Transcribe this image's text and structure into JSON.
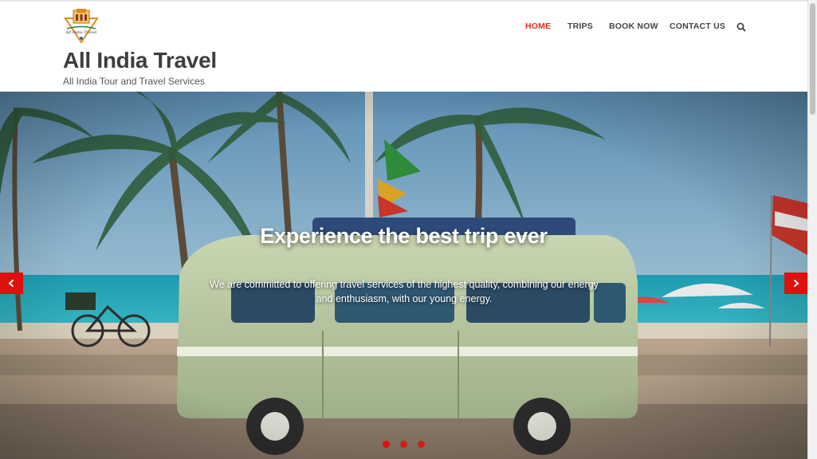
{
  "site": {
    "title": "All India Travel",
    "tagline": "All India Tour and Travel Services",
    "logo_text": "All India Travel"
  },
  "nav": {
    "items": [
      {
        "label": "HOME",
        "active": true
      },
      {
        "label": "TRIPS",
        "active": false
      },
      {
        "label": "BOOK NOW",
        "active": false
      },
      {
        "label": "CONTACT US",
        "active": false
      }
    ],
    "search_icon": "search-icon"
  },
  "hero": {
    "title": "Experience the best trip ever",
    "text": "We are committed to offering travel services of the highest quality, combining our energy and enthusiasm, with our young energy.",
    "prev_icon": "chevron-left-icon",
    "next_icon": "chevron-right-icon",
    "slide_count": 3,
    "active_slide": 1
  },
  "colors": {
    "accent": "#e02b20",
    "title": "#3d3d3d",
    "slider_control": "#e0100c"
  }
}
